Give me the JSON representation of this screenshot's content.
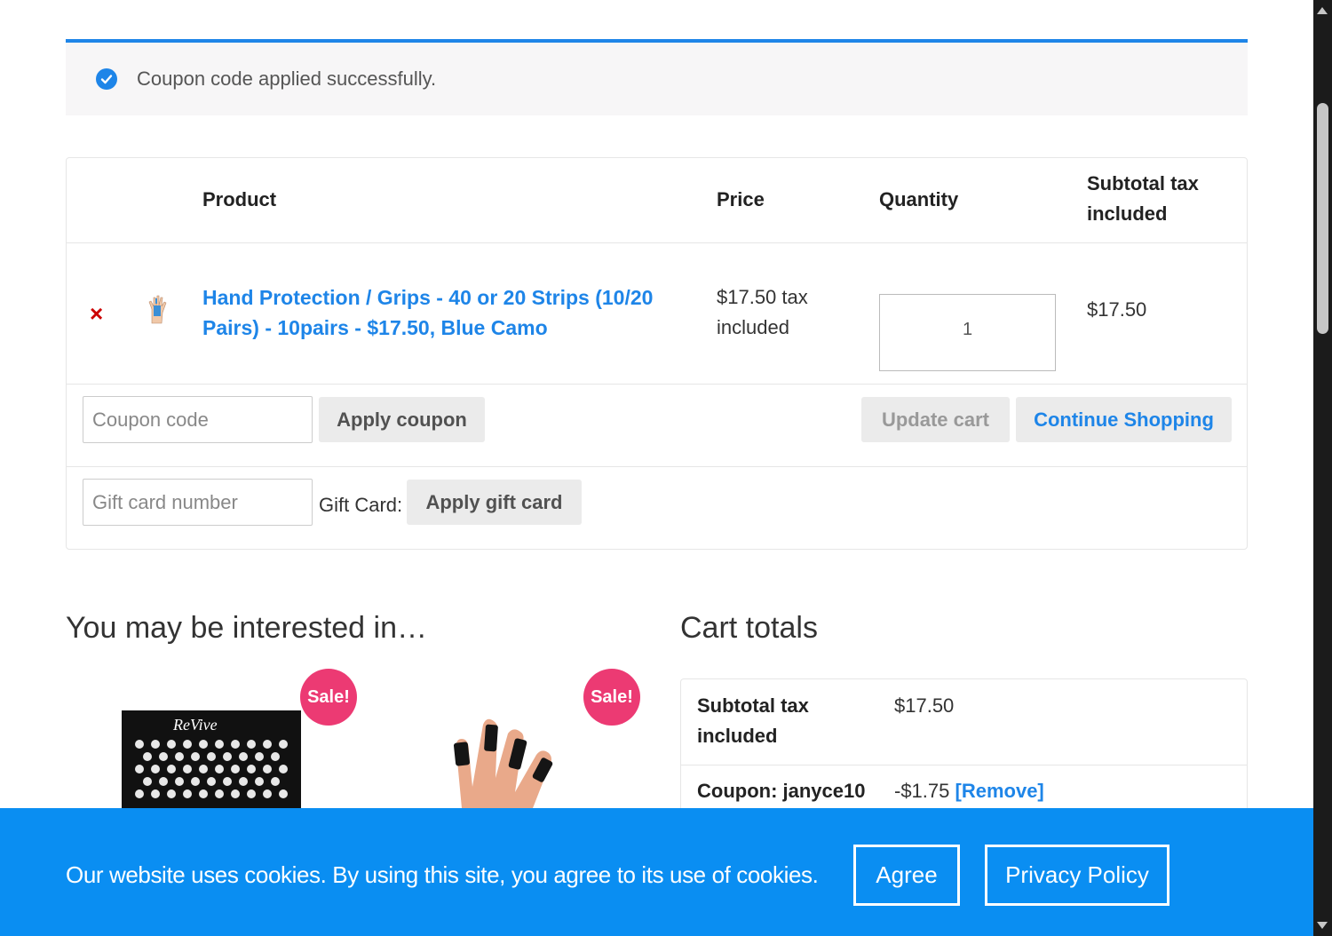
{
  "notice": {
    "message": "Coupon code applied successfully.",
    "icon": "check-circle-icon",
    "accent": "#1e85e8"
  },
  "cart": {
    "headers": {
      "product": "Product",
      "price": "Price",
      "quantity": "Quantity",
      "subtotal": "Subtotal tax included"
    },
    "items": [
      {
        "remove_icon": "×",
        "name": "Hand Protection / Grips - 40 or 20 Strips (10/20 Pairs) - 10pairs - $17.50, Blue Camo",
        "price": "$17.50 tax included",
        "quantity": "1",
        "subtotal": "$17.50"
      }
    ],
    "coupon_placeholder": "Coupon code",
    "apply_coupon": "Apply coupon",
    "update_cart": "Update cart",
    "continue_shopping": "Continue Shopping",
    "gift_placeholder": "Gift card number",
    "gift_label": "Gift Card:",
    "apply_gift": "Apply gift card"
  },
  "upsell": {
    "heading": "You may be interested in…",
    "sale_badge": "Sale!",
    "product1_logo_text": "ReVive"
  },
  "totals": {
    "heading": "Cart totals",
    "subtotal_label": "Subtotal tax included",
    "subtotal_value": "$17.50",
    "coupon_label": "Coupon: janyce10",
    "coupon_value": "-$1.75",
    "coupon_remove": "[Remove]"
  },
  "cookie": {
    "text": "Our website uses cookies. By using this site, you agree to its use of cookies.",
    "agree": "Agree",
    "privacy": "Privacy Policy",
    "background": "#0a8ef2"
  },
  "colors": {
    "link": "#1e85e8",
    "sale": "#ec3a73",
    "remove": "#cc0000"
  }
}
